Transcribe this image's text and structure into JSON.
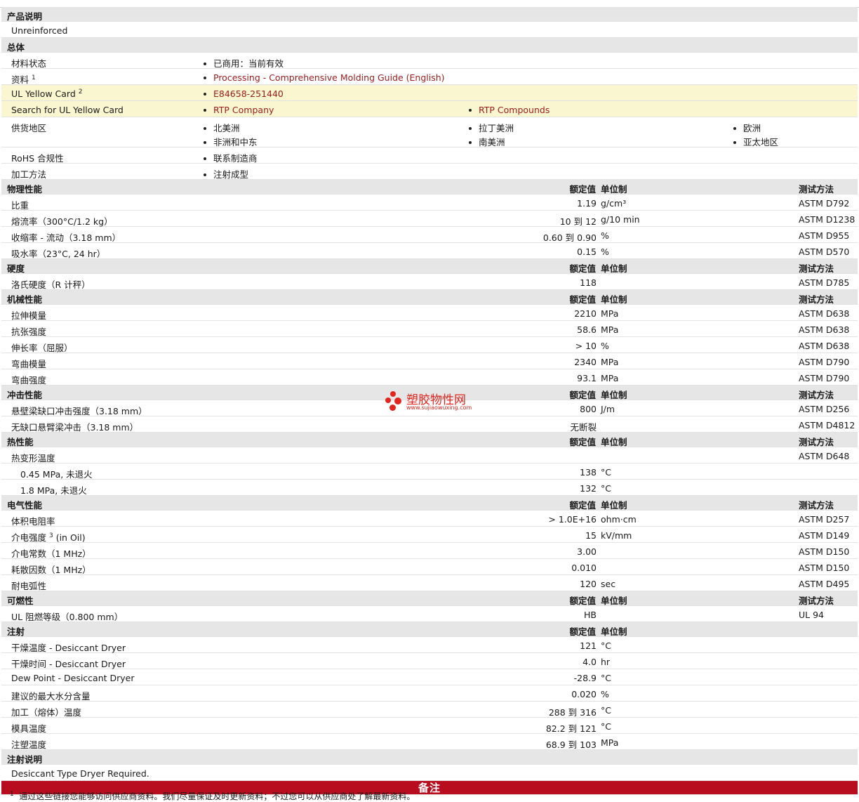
{
  "product_desc": {
    "title": "产品说明",
    "text": "Unreinforced"
  },
  "general": {
    "title": "总体",
    "material_status": {
      "label": "材料状态",
      "value": "已商用：当前有效"
    },
    "documents": {
      "label": "资料",
      "sup": "1",
      "value": "Processing - Comprehensive Molding Guide (English)"
    },
    "ul_card": {
      "label": "UL Yellow Card",
      "sup": "2",
      "value": "E84658-251440"
    },
    "ul_search": {
      "label": "Search for UL Yellow Card",
      "v1": "RTP Company",
      "v2": "RTP Compounds"
    },
    "supply": {
      "label": "供货地区",
      "items": [
        "北美洲",
        "拉丁美洲",
        "欧洲",
        "非洲和中东",
        "南美洲",
        "亚太地区"
      ]
    },
    "rohs": {
      "label": "RoHS 合规性",
      "value": "联系制造商"
    },
    "processing": {
      "label": "加工方法",
      "value": "注射成型"
    }
  },
  "headers": {
    "value": "额定值",
    "unit": "单位制",
    "method": "测试方法"
  },
  "sections": [
    {
      "title": "物理性能",
      "rows": [
        {
          "label": "比重",
          "value": "1.19",
          "unit": "g/cm³",
          "method": "ASTM D792"
        },
        {
          "label": "熔流率（300°C/1.2 kg）",
          "value": "10 到  12",
          "unit": "g/10 min",
          "method": "ASTM D1238"
        },
        {
          "label": "收缩率  - 流动（3.18 mm）",
          "value": "0.60 到  0.90",
          "unit": "%",
          "method": "ASTM D955"
        },
        {
          "label": "吸水率（23°C, 24 hr）",
          "value": "0.15",
          "unit": "%",
          "method": "ASTM D570"
        }
      ]
    },
    {
      "title": "硬度",
      "rows": [
        {
          "label": "洛氏硬度（R 计秤）",
          "value": "118",
          "unit": "",
          "method": "ASTM D785"
        }
      ]
    },
    {
      "title": "机械性能",
      "rows": [
        {
          "label": "拉伸模量",
          "value": "2210",
          "unit": "MPa",
          "method": "ASTM D638"
        },
        {
          "label": "抗张强度",
          "value": "58.6",
          "unit": "MPa",
          "method": "ASTM D638"
        },
        {
          "label": "伸长率（屈服）",
          "value": "> 10",
          "unit": "%",
          "method": "ASTM D638"
        },
        {
          "label": "弯曲模量",
          "value": "2340",
          "unit": "MPa",
          "method": "ASTM D790"
        },
        {
          "label": "弯曲强度",
          "value": "93.1",
          "unit": "MPa",
          "method": "ASTM D790"
        }
      ]
    },
    {
      "title": "冲击性能",
      "rows": [
        {
          "label": "悬壁梁缺口冲击强度（3.18 mm）",
          "value": "800",
          "unit": "J/m",
          "method": "ASTM D256"
        },
        {
          "label": "无缺口悬臂梁冲击（3.18 mm）",
          "value": "无断裂",
          "unit": "",
          "method": "ASTM D4812"
        }
      ]
    },
    {
      "title": "热性能",
      "rows": [
        {
          "label": "热变形温度",
          "value": "",
          "unit": "",
          "method": "ASTM D648"
        },
        {
          "label": "0.45 MPa, 未退火",
          "value": "138",
          "unit": "°C",
          "method": "",
          "indent": true
        },
        {
          "label": "1.8 MPa, 未退火",
          "value": "132",
          "unit": "°C",
          "method": "",
          "indent": true
        }
      ]
    },
    {
      "title": "电气性能",
      "rows": [
        {
          "label": "体积电阻率",
          "value": "> 1.0E+16",
          "unit": "ohm·cm",
          "method": "ASTM D257"
        },
        {
          "label": "介电强度",
          "sup": "3",
          "suffix": " (in Oil)",
          "value": "15",
          "unit": "kV/mm",
          "method": "ASTM D149"
        },
        {
          "label": "介电常数（1 MHz）",
          "value": "3.00",
          "unit": "",
          "method": "ASTM D150"
        },
        {
          "label": "耗散因数（1 MHz）",
          "value": "0.010",
          "unit": "",
          "method": "ASTM D150"
        },
        {
          "label": "耐电弧性",
          "value": "120",
          "unit": "sec",
          "method": "ASTM D495"
        }
      ]
    },
    {
      "title": "可燃性",
      "rows": [
        {
          "label": "UL 阻燃等级（0.800 mm）",
          "value": "HB",
          "unit": "",
          "method": "UL 94"
        }
      ]
    },
    {
      "title": "注射",
      "nomethod": true,
      "rows": [
        {
          "label": "干燥温度  - Desiccant Dryer",
          "value": "121",
          "unit": "°C",
          "method": ""
        },
        {
          "label": "干燥时间  - Desiccant Dryer",
          "value": "4.0",
          "unit": "hr",
          "method": ""
        },
        {
          "label": "Dew Point - Desiccant Dryer",
          "value": "-28.9",
          "unit": "°C",
          "method": ""
        },
        {
          "label": "建议的最大水分含量",
          "value": "0.020",
          "unit": "%",
          "method": ""
        },
        {
          "label": "加工（熔体）温度",
          "value": "288 到  316",
          "unit": "°C",
          "method": ""
        },
        {
          "label": "模具温度",
          "value": "82.2 到  121",
          "unit": "°C",
          "method": ""
        },
        {
          "label": "注塑温度",
          "value": "68.9 到  103",
          "unit": "MPa",
          "method": ""
        }
      ]
    }
  ],
  "injection_notes": {
    "title": "注射说明",
    "text": "Desiccant Type Dryer Required."
  },
  "notes_bar": "备注",
  "footnote": {
    "sup": "1",
    "text": "通过这些链接您能够访问供应商资料。我们尽量保证及时更新资料；不过您可以从供应商处了解最新资料。"
  },
  "watermark": {
    "title": "塑胶物性网",
    "url": "www.sujiaowuxing.com",
    "color": "#e2261d"
  }
}
